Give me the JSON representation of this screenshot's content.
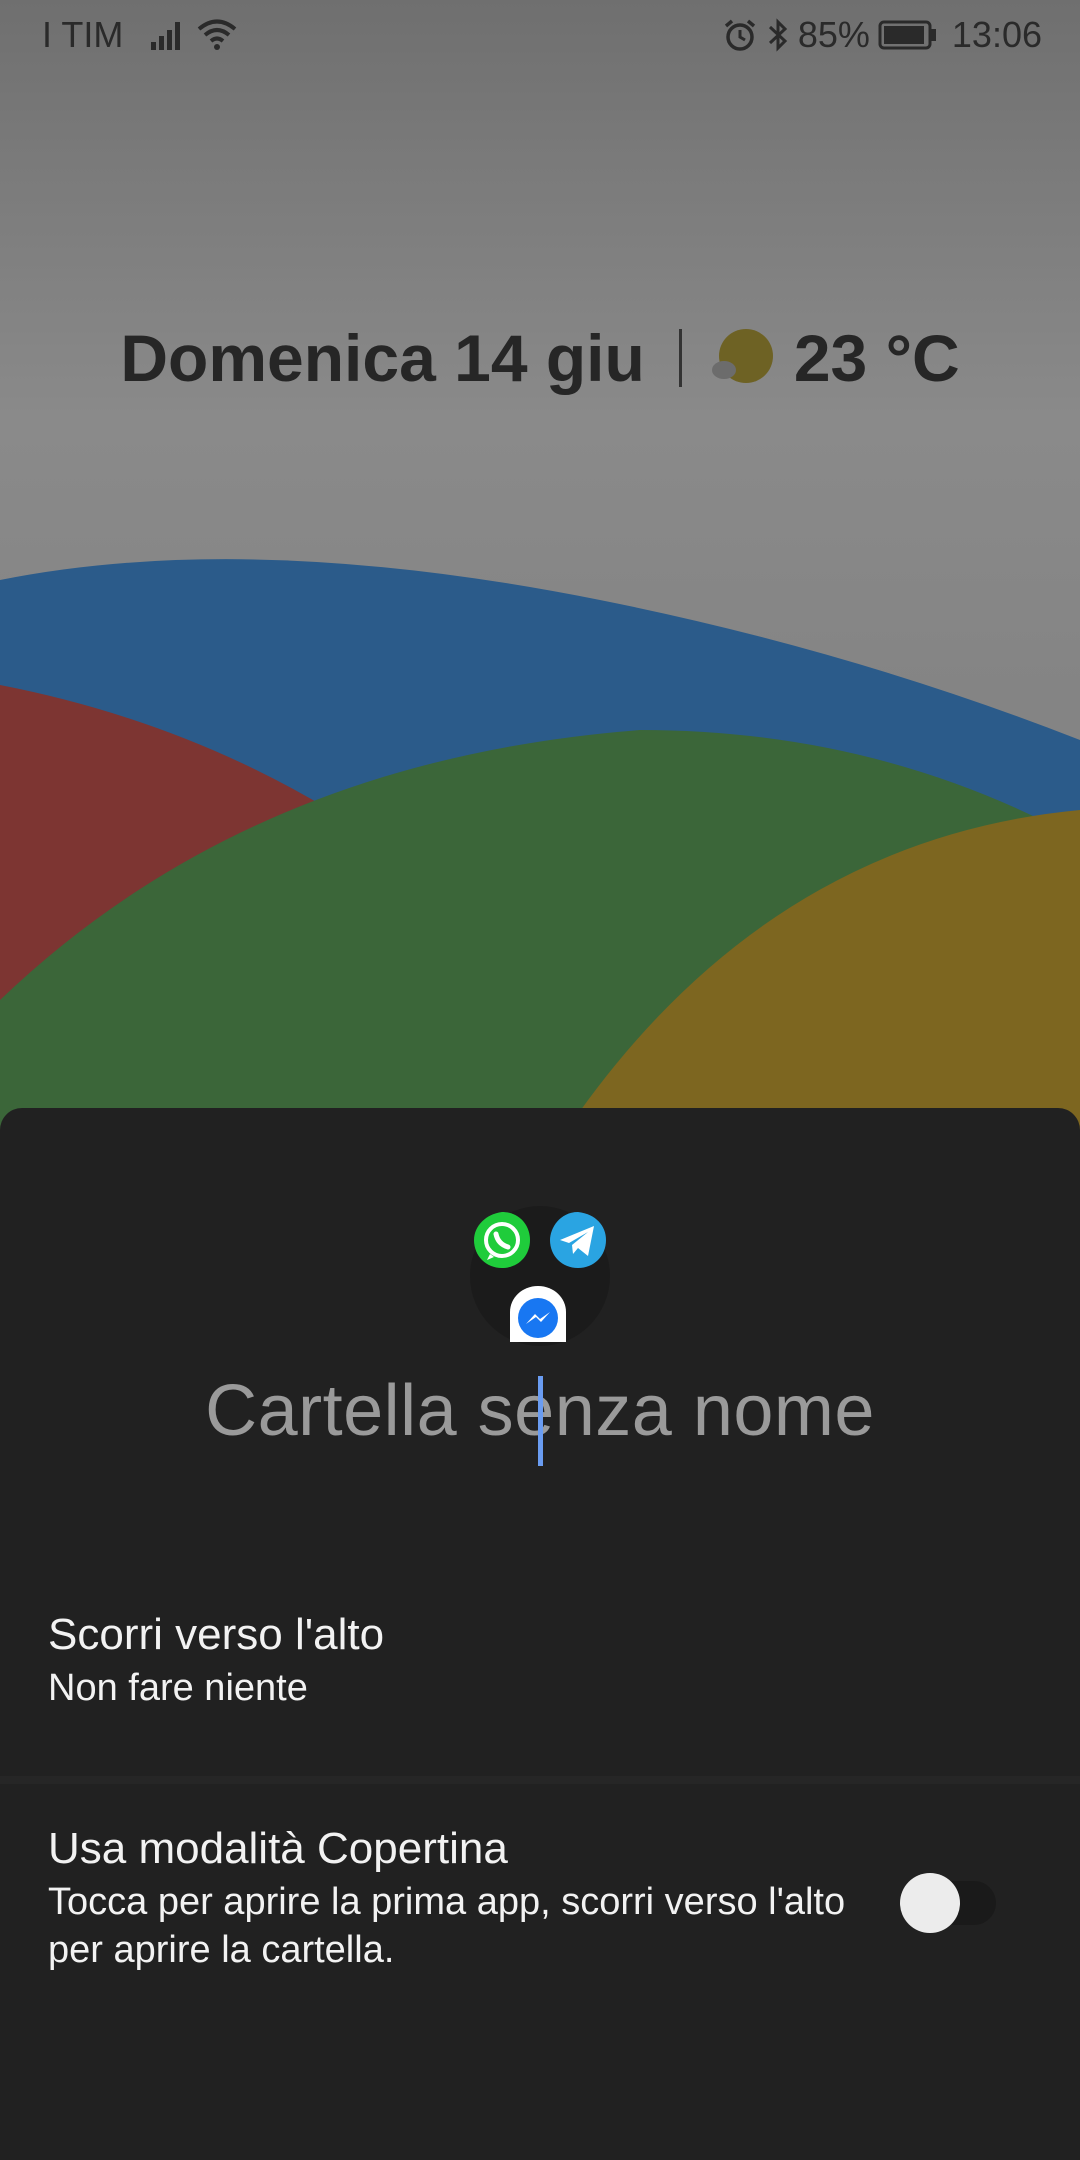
{
  "status_bar": {
    "carrier": "I TIM",
    "battery_percent": "85%",
    "time": "13:06",
    "icons": [
      "signal-icon",
      "wifi-icon",
      "alarm-icon",
      "bluetooth-icon",
      "battery-icon"
    ]
  },
  "widget": {
    "date": "Domenica 14 giu",
    "temperature": "23 °C",
    "weather_icon": "partly-cloudy-icon"
  },
  "folder": {
    "name_placeholder": "Cartella senza nome",
    "apps": [
      "whatsapp-icon",
      "telegram-icon",
      "messenger-icon"
    ],
    "swipe_up": {
      "title": "Scorri verso l'alto",
      "value": "Non fare niente"
    },
    "cover_mode": {
      "title": "Usa modalità Copertina",
      "description": "Tocca per aprire la prima app, scorri verso l'alto per aprire la cartella.",
      "enabled": false
    }
  },
  "colors": {
    "sheet_background": "#212121",
    "cursor": "#6a9cf1",
    "wallpaper_blue": "#2b5b8a",
    "wallpaper_red": "#7d3532",
    "wallpaper_green": "#3b6639",
    "wallpaper_yellow": "#7d6620"
  }
}
